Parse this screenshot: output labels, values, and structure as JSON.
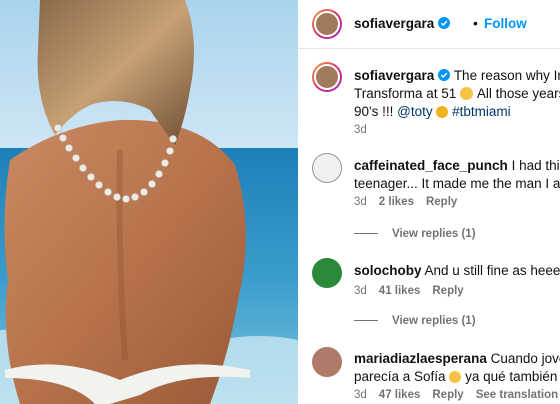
{
  "post": {
    "author": "sofiavergara",
    "follow_label": "Follow",
    "separator": "•",
    "caption_text": "The reason why Im re",
    "caption_line2_a": "Transforma at 51",
    "caption_line2_b": "All those years of",
    "caption_line3_a": "90's !!!",
    "caption_mention": "@toty",
    "caption_hashtag": "#tbtmiami",
    "caption_time": "3d"
  },
  "comments": [
    {
      "username": "caffeinated_face_punch",
      "text_line1": "I had this pos",
      "text_line2": "teenager... It made me the man I am t",
      "time": "3d",
      "likes": "2 likes",
      "reply": "Reply",
      "view_replies": "View replies (1)"
    },
    {
      "username": "solochoby",
      "text_line1": "And u still fine as heeeeee",
      "time": "3d",
      "likes": "41 likes",
      "reply": "Reply",
      "view_replies": "View replies (1)"
    },
    {
      "username": "mariadiazlaesperana",
      "text_line1": "Cuando joven y",
      "text_line2_a": "parecía a Sofía",
      "text_line2_b": "ya qué también m",
      "time": "3d",
      "likes": "47 likes",
      "reply": "Reply",
      "see_translation": "See translation"
    }
  ],
  "colors": {
    "link": "#00376b",
    "follow": "#0095f6",
    "muted": "#737373"
  }
}
